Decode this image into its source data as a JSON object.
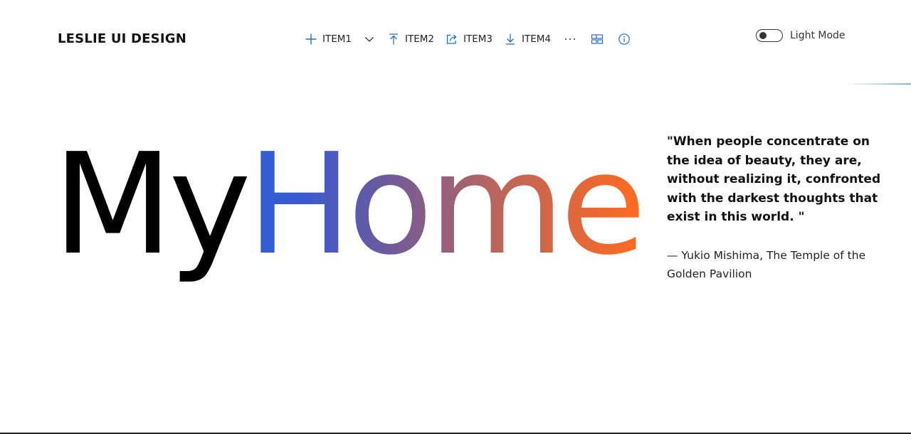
{
  "brand": {
    "title": "LESLIE UI DESIGN"
  },
  "commandbar": {
    "item1": {
      "label": "ITEM1",
      "icon": "plus-icon"
    },
    "item1_dropdown": {
      "icon": "chevron-down-icon"
    },
    "item2": {
      "label": "ITEM2",
      "icon": "upload-icon"
    },
    "item3": {
      "label": "ITEM3",
      "icon": "share-icon"
    },
    "item4": {
      "label": "ITEM4",
      "icon": "download-icon"
    },
    "more": {
      "icon": "more-icon",
      "label": "···"
    },
    "layout": {
      "icon": "layout-icon"
    },
    "info": {
      "icon": "info-icon"
    }
  },
  "theme_toggle": {
    "label": "Light Mode",
    "state": "off"
  },
  "hero": {
    "part1": "My",
    "part2": "Home"
  },
  "quote": {
    "text": "\"When people concentrate on the idea of beauty, they are, without realizing it, confronted with the darkest thoughts that exist in this world. \"",
    "attribution": "— Yukio Mishima, The Temple of the Golden Pavilion"
  },
  "colors": {
    "accent_blue": "#2f5fd6",
    "gradient_end_orange": "#ff6a1f",
    "icon_blue": "#1f6fc5"
  }
}
